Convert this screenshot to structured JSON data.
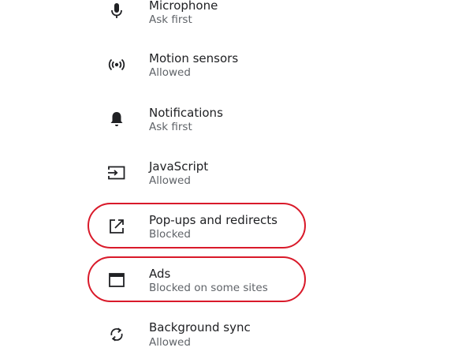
{
  "settings": [
    {
      "icon": "microphone-icon",
      "title": "Microphone",
      "subtitle": "Ask first"
    },
    {
      "icon": "motion-sensors-icon",
      "title": "Motion sensors",
      "subtitle": "Allowed"
    },
    {
      "icon": "bell-icon",
      "title": "Notifications",
      "subtitle": "Ask first"
    },
    {
      "icon": "javascript-icon",
      "title": "JavaScript",
      "subtitle": "Allowed"
    },
    {
      "icon": "external-link-icon",
      "title": "Pop-ups and redirects",
      "subtitle": "Blocked"
    },
    {
      "icon": "ad-window-icon",
      "title": "Ads",
      "subtitle": "Blocked on some sites"
    },
    {
      "icon": "sync-icon",
      "title": "Background sync",
      "subtitle": "Allowed"
    }
  ],
  "highlight_color": "#d91a2a"
}
